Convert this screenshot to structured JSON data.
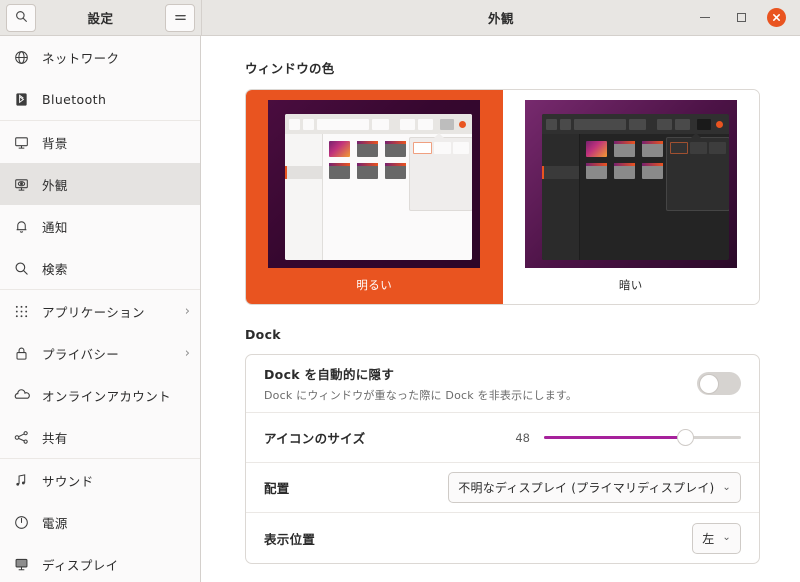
{
  "sidebar_header": {
    "title": "設定",
    "search_icon": "search-icon",
    "menu_icon": "hamburger-menu-icon"
  },
  "window": {
    "title": "外観",
    "minimize_label": "—",
    "maximize_label": "□",
    "close_label": "×"
  },
  "sidebar": {
    "groups": [
      {
        "items": [
          {
            "label": "ネットワーク",
            "icon": "network-globe-icon",
            "active": false,
            "chevron": ""
          },
          {
            "label": "Bluetooth",
            "icon": "bluetooth-icon",
            "active": false,
            "chevron": ""
          }
        ]
      },
      {
        "items": [
          {
            "label": "背景",
            "icon": "background-monitor-icon",
            "active": false,
            "chevron": ""
          },
          {
            "label": "外観",
            "icon": "appearance-monitor-icon",
            "active": true,
            "chevron": ""
          },
          {
            "label": "通知",
            "icon": "bell-icon",
            "active": false,
            "chevron": ""
          },
          {
            "label": "検索",
            "icon": "search-icon",
            "active": false,
            "chevron": ""
          }
        ]
      },
      {
        "items": [
          {
            "label": "アプリケーション",
            "icon": "grid-apps-icon",
            "active": false,
            "chevron": "›"
          },
          {
            "label": "プライバシー",
            "icon": "lock-icon",
            "active": false,
            "chevron": "›"
          },
          {
            "label": "オンラインアカウント",
            "icon": "cloud-icon",
            "active": false,
            "chevron": ""
          },
          {
            "label": "共有",
            "icon": "share-nodes-icon",
            "active": false,
            "chevron": ""
          }
        ]
      },
      {
        "items": [
          {
            "label": "サウンド",
            "icon": "music-note-icon",
            "active": false,
            "chevron": ""
          },
          {
            "label": "電源",
            "icon": "power-icon",
            "active": false,
            "chevron": ""
          },
          {
            "label": "ディスプレイ",
            "icon": "display-icon",
            "active": false,
            "chevron": ""
          }
        ]
      }
    ]
  },
  "main": {
    "window_color": {
      "section_title": "ウィンドウの色",
      "themes": [
        {
          "label": "明るい",
          "selected": true
        },
        {
          "label": "暗い",
          "selected": false
        }
      ]
    },
    "dock": {
      "section_title": "Dock",
      "autohide": {
        "title": "Dock を自動的に隠す",
        "subtitle": "Dock にウィンドウが重なった際に Dock を非表示にします。",
        "enabled": false
      },
      "icon_size": {
        "label": "アイコンのサイズ",
        "value": "48",
        "fill_percent": 72
      },
      "placement": {
        "label": "配置",
        "value": "不明なディスプレイ (プライマリディスプレイ)",
        "chevron": "⌄"
      },
      "position": {
        "label": "表示位置",
        "value": "左",
        "chevron": "⌄"
      }
    }
  },
  "colors": {
    "ubuntu_orange": "#e95420",
    "slider_purple": "#a6219b",
    "header_bg": "#e8e6e3",
    "sidebar_bg": "#fbfafa",
    "active_row": "#e5e3e1"
  }
}
